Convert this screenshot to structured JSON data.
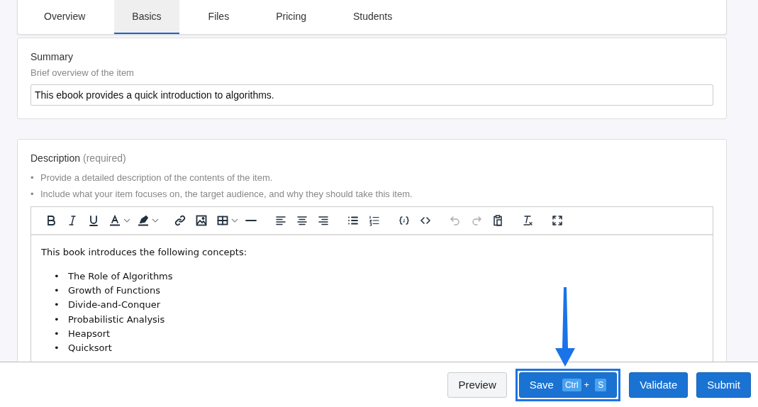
{
  "tabs": [
    {
      "label": "Overview",
      "selected": false
    },
    {
      "label": "Basics",
      "selected": true
    },
    {
      "label": "Files",
      "selected": false
    },
    {
      "label": "Pricing",
      "selected": false
    },
    {
      "label": "Students",
      "selected": false
    }
  ],
  "summary": {
    "label": "Summary",
    "hint": "Brief overview of the item",
    "value": "This ebook provides a quick introduction to algorithms."
  },
  "description": {
    "label": "Description",
    "required_note": "(required)",
    "marker": "•",
    "guidelines": [
      "Provide a detailed description of the contents of the item.",
      "Include what your item focuses on, the target audience, and why they should take this item."
    ],
    "toolbar": [
      [
        {
          "kind": "bold",
          "disabled": false
        },
        {
          "kind": "italic",
          "disabled": false
        },
        {
          "kind": "underline",
          "disabled": false
        },
        {
          "kind": "text-color",
          "disabled": false
        },
        {
          "kind": "highlight",
          "disabled": false
        }
      ],
      [
        {
          "kind": "link",
          "disabled": false
        },
        {
          "kind": "image",
          "disabled": false
        },
        {
          "kind": "table",
          "disabled": false
        },
        {
          "kind": "rule",
          "disabled": false
        }
      ],
      [
        {
          "kind": "align-left",
          "disabled": false
        },
        {
          "kind": "align-center",
          "disabled": false
        },
        {
          "kind": "align-right",
          "disabled": false
        }
      ],
      [
        {
          "kind": "bullet-list",
          "disabled": false
        },
        {
          "kind": "numbered-list",
          "disabled": false
        }
      ],
      [
        {
          "kind": "code-block",
          "disabled": false
        },
        {
          "kind": "code",
          "disabled": false
        }
      ],
      [
        {
          "kind": "undo",
          "disabled": true
        },
        {
          "kind": "redo",
          "disabled": true
        },
        {
          "kind": "paste",
          "disabled": false
        }
      ],
      [
        {
          "kind": "clear-format",
          "disabled": false
        }
      ],
      [
        {
          "kind": "fullscreen",
          "disabled": false
        }
      ]
    ],
    "content": {
      "intro": "This book introduces the following concepts:",
      "items": [
        "The Role of Algorithms",
        "Growth of Functions",
        "Divide-and-Conquer",
        "Probabilistic Analysis",
        "Heapsort",
        "Quicksort"
      ]
    }
  },
  "footer": {
    "buttons": [
      {
        "kind": "secondary",
        "label": "Preview",
        "highlighted": false
      },
      {
        "kind": "primary",
        "label": "Save",
        "shortcut": [
          "Ctrl",
          "+",
          "S"
        ],
        "highlighted": true
      },
      {
        "kind": "primary",
        "label": "Validate",
        "highlighted": false
      },
      {
        "kind": "primary",
        "label": "Submit",
        "highlighted": false
      }
    ]
  }
}
